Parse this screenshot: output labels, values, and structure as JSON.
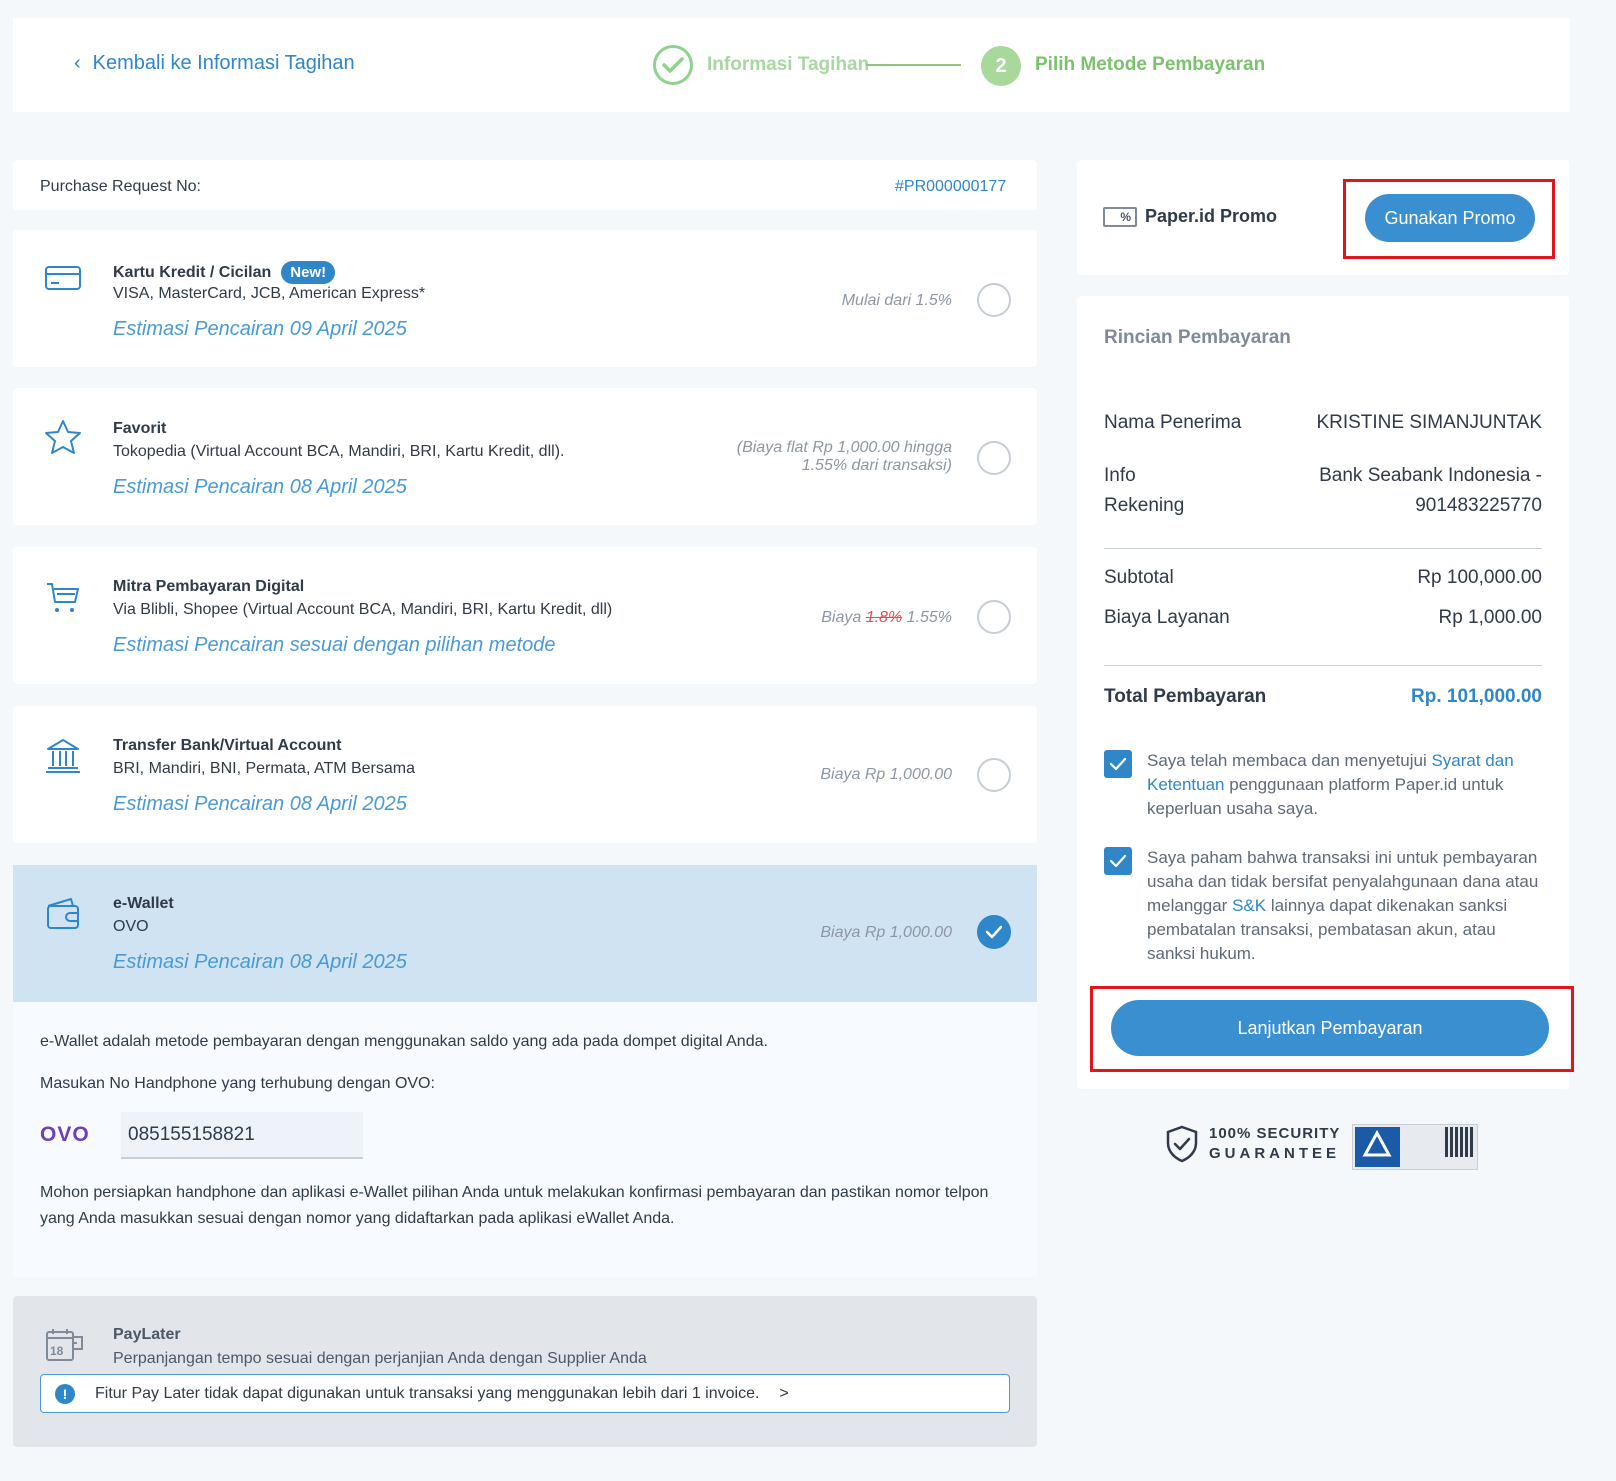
{
  "header": {
    "back_label": "Kembali ke Informasi Tagihan",
    "step1_label": "Informasi Tagihan",
    "step2_number": "2",
    "step2_label": "Pilih Metode Pembayaran"
  },
  "purchase_request": {
    "label": "Purchase Request No:",
    "value": "#PR000000177"
  },
  "methods": [
    {
      "title": "Kartu Kredit / Cicilan",
      "badge": "New!",
      "subtitle": "VISA, MasterCard, JCB, American Express*",
      "estimate": "Estimasi Pencairan  09 April 2025",
      "fee": "Mulai dari 1.5%",
      "icon": "credit-card-icon",
      "selected": false
    },
    {
      "title": "Favorit",
      "subtitle": "Tokopedia (Virtual Account BCA, Mandiri, BRI, Kartu Kredit, dll).",
      "estimate": "Estimasi Pencairan  08 April 2025",
      "fee_line1": "(Biaya flat Rp 1,000.00 hingga",
      "fee_line2": "1.55% dari transaksi)",
      "icon": "star-icon",
      "selected": false
    },
    {
      "title": "Mitra Pembayaran Digital",
      "subtitle": "Via Blibli, Shopee (Virtual Account BCA, Mandiri, BRI, Kartu Kredit, dll)",
      "estimate": "Estimasi Pencairan sesuai dengan pilihan metode",
      "fee_prefix": "Biaya",
      "fee_old": "1.8%",
      "fee_new": "1.55%",
      "icon": "cart-icon",
      "selected": false
    },
    {
      "title": "Transfer Bank/Virtual Account",
      "subtitle": "BRI, Mandiri, BNI, Permata, ATM Bersama",
      "estimate": "Estimasi Pencairan  08 April 2025",
      "fee": "Biaya Rp 1,000.00",
      "icon": "bank-icon",
      "selected": false
    },
    {
      "title": "e-Wallet",
      "subtitle": "OVO",
      "estimate": "Estimasi Pencairan  08 April 2025",
      "fee": "Biaya Rp 1,000.00",
      "icon": "wallet-icon",
      "selected": true
    }
  ],
  "ewallet": {
    "description": "e-Wallet adalah metode pembayaran dengan menggunakan saldo yang ada pada dompet digital Anda.",
    "prompt": "Masukan No Handphone yang terhubung dengan OVO:",
    "logo_text": "OVO",
    "phone_value": "085155158821",
    "note": "Mohon persiapkan handphone dan aplikasi e-Wallet pilihan Anda untuk melakukan konfirmasi pembayaran dan pastikan nomor telpon yang Anda masukkan sesuai dengan nomor yang didaftarkan pada aplikasi eWallet Anda."
  },
  "paylater": {
    "title": "PayLater",
    "subtitle": "Perpanjangan tempo sesuai dengan perjanjian Anda dengan Supplier Anda",
    "calendar_day": "18",
    "alert": "Fitur Pay Later tidak dapat digunakan untuk transaksi yang menggunakan lebih dari 1 invoice.",
    "alert_arrow": ">"
  },
  "promo": {
    "icon_text": "%",
    "label": "Paper.id Promo",
    "button_label": "Gunakan Promo"
  },
  "summary": {
    "title": "Rincian Pembayaran",
    "recipient_label": "Nama Penerima",
    "recipient_value": "KRISTINE SIMANJUNTAK",
    "account_label_1": "Info",
    "account_label_2": "Rekening",
    "account_value_1": "Bank Seabank Indonesia -",
    "account_value_2": "901483225770",
    "subtotal_label": "Subtotal",
    "subtotal_value": "Rp 100,000.00",
    "fee_label": "Biaya Layanan",
    "fee_value": "Rp 1,000.00",
    "total_label": "Total Pembayaran",
    "total_value": "Rp. 101,000.00"
  },
  "agreements": {
    "a1_before": "Saya telah membaca dan menyetujui ",
    "a1_link": "Syarat dan Ketentuan",
    "a1_after": " penggunaan platform Paper.id untuk keperluan usaha saya.",
    "a2_before": "Saya paham bahwa transaksi ini untuk pembayaran usaha dan tidak bersifat penyalahgunaan dana atau melanggar ",
    "a2_link": "S&K",
    "a2_after": " lainnya dapat dikenakan sanksi pembatalan transaksi, pembatasan akun, atau sanksi hukum."
  },
  "cta_label": "Lanjutkan Pembayaran",
  "security": {
    "line1": "100% SECURITY",
    "line2": "GUARANTEE"
  },
  "colors": {
    "primary": "#3a8fd0",
    "selected_bg": "#cfe3f3",
    "highlight_red": "#e0161e",
    "step_green": "#7cc26e"
  }
}
